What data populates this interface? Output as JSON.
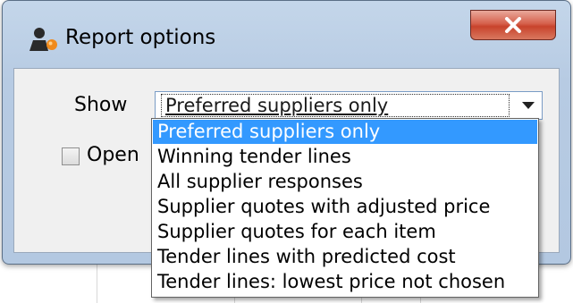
{
  "window": {
    "title": "Report options",
    "close_symbol": "X",
    "colors": {
      "close_button": "#c8432c",
      "frame": "#b7cbe3",
      "selection": "#3399ff"
    }
  },
  "form": {
    "show_label": "Show",
    "show_value": "Preferred suppliers only",
    "open_label": "Open",
    "open_checked": false
  },
  "dropdown": {
    "selected_index": 0,
    "options": [
      "Preferred suppliers only",
      "Winning tender lines",
      "All supplier responses",
      "Supplier quotes with adjusted price",
      "Supplier quotes for each item",
      "Tender lines with predicted cost",
      "Tender lines: lowest price not chosen"
    ]
  },
  "icons": {
    "title_icon": "report-person-icon",
    "dropdown_arrow": "chevron-down-icon",
    "close": "close-icon"
  }
}
